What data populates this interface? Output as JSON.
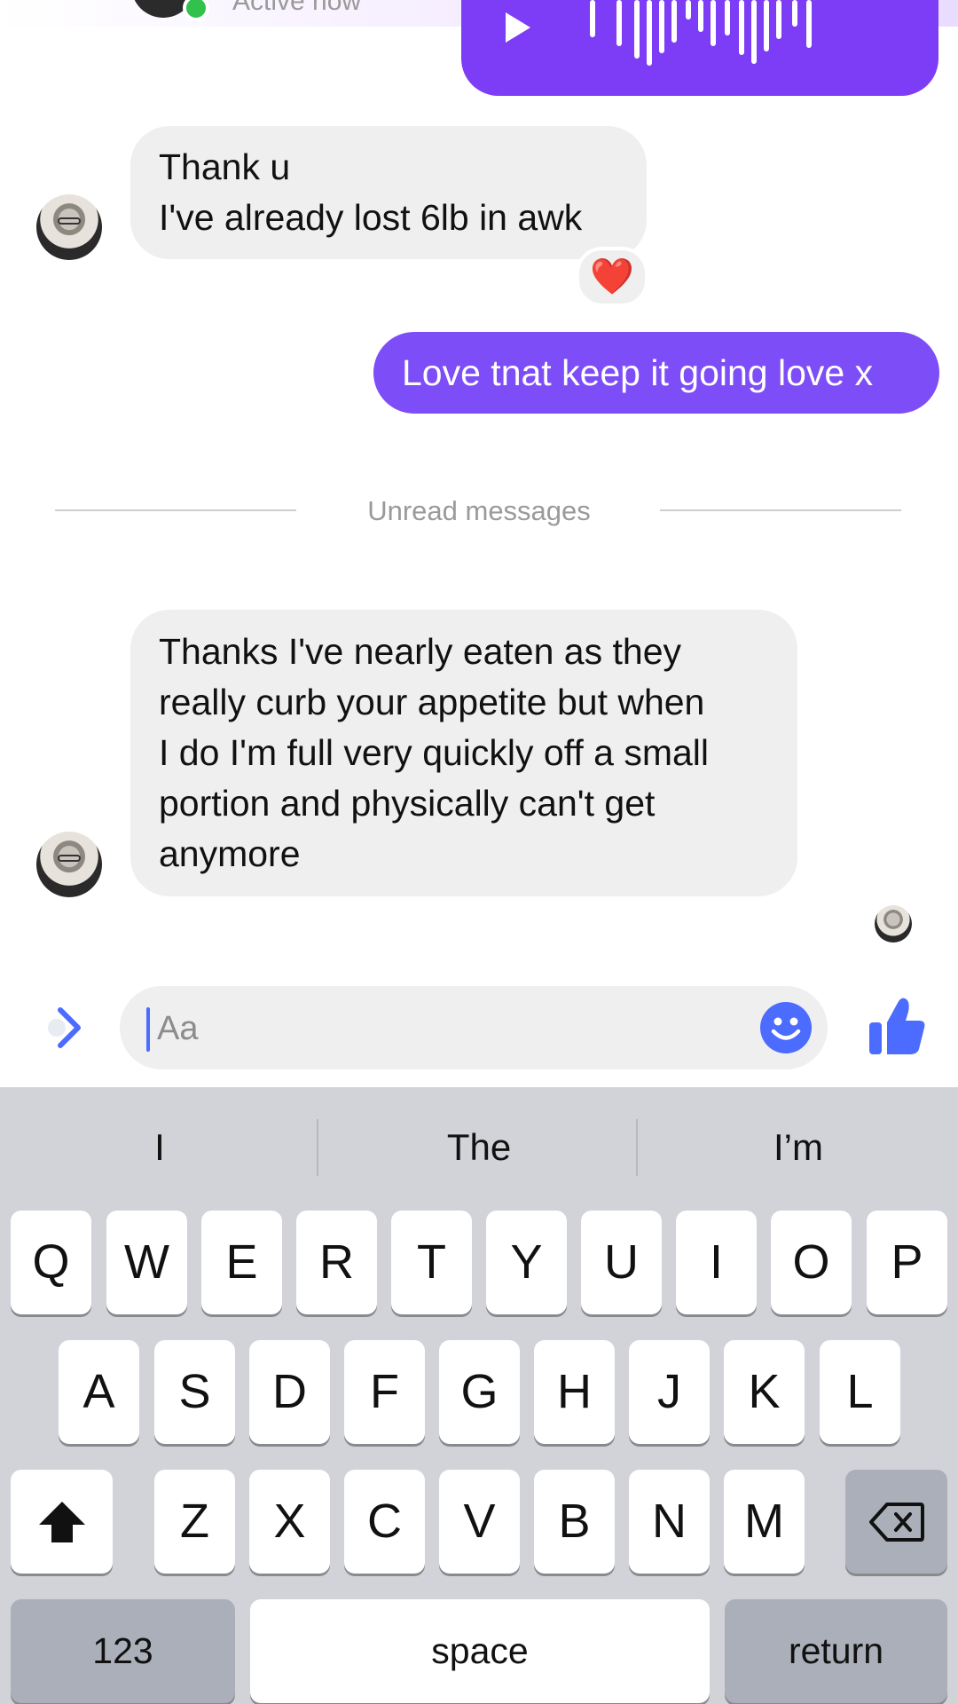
{
  "header": {
    "status": "Active now"
  },
  "messages": {
    "incoming_1": {
      "lines": [
        "Thank u",
        "I've already lost 6lb in awk"
      ],
      "reaction": "❤️"
    },
    "outgoing_1": {
      "text": "Love tnat keep it going love x"
    },
    "divider": "Unread messages",
    "incoming_2": {
      "lines": [
        "Thanks I've nearly eaten as they",
        "really curb your appetite but when",
        "I do I'm full very quickly off a small",
        "portion and physically can't get",
        "anymore"
      ]
    }
  },
  "composer": {
    "placeholder": "Aa",
    "value": ""
  },
  "keyboard": {
    "suggestions": [
      "I",
      "The",
      "I’m"
    ],
    "row1": [
      "Q",
      "W",
      "E",
      "R",
      "T",
      "Y",
      "U",
      "I",
      "O",
      "P"
    ],
    "row2": [
      "A",
      "S",
      "D",
      "F",
      "G",
      "H",
      "J",
      "K",
      "L"
    ],
    "row3": [
      "Z",
      "X",
      "C",
      "V",
      "B",
      "N",
      "M"
    ],
    "numbers_label": "123",
    "space_label": "space",
    "return_label": "return"
  },
  "colors": {
    "accent": "#7d4df7",
    "messenger_blue": "#4c6bff",
    "online": "#31c24d"
  }
}
